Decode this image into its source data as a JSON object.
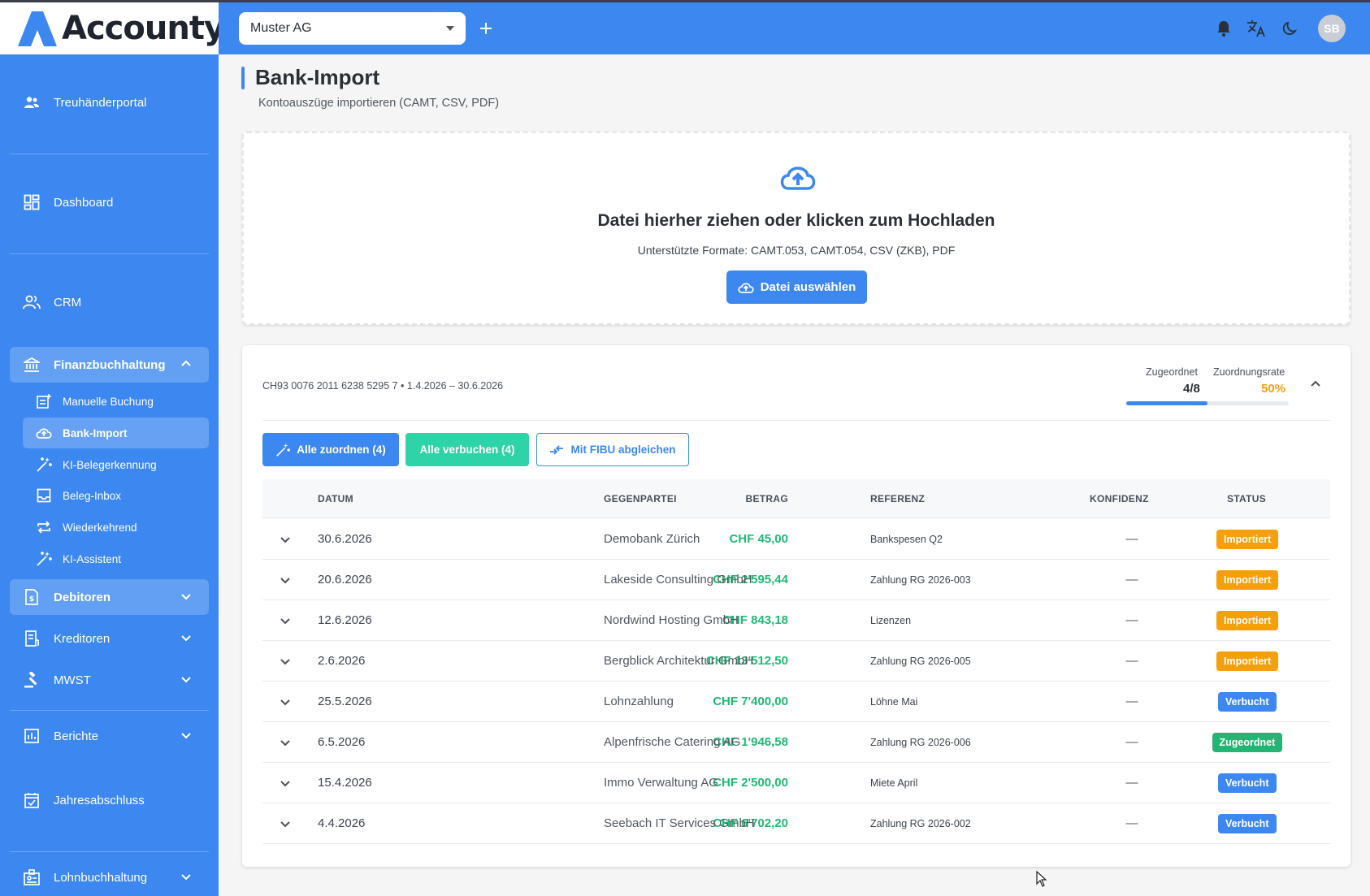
{
  "app": {
    "name": "Accounty",
    "brand_color": "#3d87f0"
  },
  "topbar": {
    "company": "Muster AG",
    "user_initials": "SB"
  },
  "sidebar": {
    "items": [
      {
        "label": "Treuhänderportal"
      },
      {
        "label": "Dashboard"
      },
      {
        "label": "CRM"
      },
      {
        "label": "Finanzbuchhaltung"
      },
      {
        "label": "Debitoren"
      },
      {
        "label": "Kreditoren"
      },
      {
        "label": "MWST"
      },
      {
        "label": "Berichte"
      },
      {
        "label": "Jahresabschluss"
      },
      {
        "label": "Lohnbuchhaltung"
      }
    ],
    "sub_items": [
      {
        "label": "Manuelle Buchung"
      },
      {
        "label": "Bank-Import"
      },
      {
        "label": "KI-Belegerkennung"
      },
      {
        "label": "Beleg-Inbox"
      },
      {
        "label": "Wiederkehrend"
      },
      {
        "label": "KI-Assistent"
      }
    ]
  },
  "page": {
    "title": "Bank-Import",
    "subtitle": "Kontoauszüge importieren (CAMT, CSV, PDF)"
  },
  "upload": {
    "title": "Datei hierher ziehen oder klicken zum Hochladen",
    "formats": "Unterstützte Formate: CAMT.053, CAMT.054, CSV (ZKB), PDF",
    "button": "Datei auswählen"
  },
  "statement": {
    "account_info": "CH93 0076 2011 6238 5295 7 • 1.4.2026 – 30.6.2026",
    "assigned_label": "Zugeordnet",
    "assigned_value": "4/8",
    "rate_label": "Zuordnungsrate",
    "rate_value": "50%",
    "assigned_fraction": 0.5,
    "actions": {
      "assign_all": "Alle zuordnen (4)",
      "book_all": "Alle verbuchen (4)",
      "reconcile": "Mit FIBU abgleichen"
    },
    "columns": {
      "date": "DATUM",
      "amount": "BETRAG",
      "party": "GEGENPARTEI",
      "reference": "REFERENZ",
      "confidence": "KONFIDENZ",
      "status": "STATUS"
    },
    "rows": [
      {
        "date": "30.6.2026",
        "amount": "CHF 45,00",
        "party": "Demobank Zürich",
        "reference": "Bankspesen Q2",
        "confidence": "—",
        "status": "Importiert",
        "status_color": "#f5a00b"
      },
      {
        "date": "20.6.2026",
        "amount": "CHF 2'595,44",
        "party": "Lakeside Consulting GmbH",
        "reference": "Zahlung RG 2026-003",
        "confidence": "—",
        "status": "Importiert",
        "status_color": "#f5a00b"
      },
      {
        "date": "12.6.2026",
        "amount": "CHF 843,18",
        "party": "Nordwind Hosting GmbH",
        "reference": "Lizenzen",
        "confidence": "—",
        "status": "Importiert",
        "status_color": "#f5a00b"
      },
      {
        "date": "2.6.2026",
        "amount": "CHF 13'512,50",
        "party": "Bergblick Architektur GmbH",
        "reference": "Zahlung RG 2026-005",
        "confidence": "—",
        "status": "Importiert",
        "status_color": "#f5a00b"
      },
      {
        "date": "25.5.2026",
        "amount": "CHF 7'400,00",
        "party": "Lohnzahlung",
        "reference": "Löhne Mai",
        "confidence": "—",
        "status": "Verbucht",
        "status_color": "#3d87f0"
      },
      {
        "date": "6.5.2026",
        "amount": "CHF 1'946,58",
        "party": "Alpenfrische Catering AG",
        "reference": "Zahlung RG 2026-006",
        "confidence": "—",
        "status": "Zugeordnet",
        "status_color": "#22b573"
      },
      {
        "date": "15.4.2026",
        "amount": "CHF 2'500,00",
        "party": "Immo Verwaltung AG",
        "reference": "Miete April",
        "confidence": "—",
        "status": "Verbucht",
        "status_color": "#3d87f0"
      },
      {
        "date": "4.4.2026",
        "amount": "CHF 6'702,20",
        "party": "Seebach IT Services GmbH",
        "reference": "Zahlung RG 2026-002",
        "confidence": "—",
        "status": "Verbucht",
        "status_color": "#3d87f0"
      }
    ]
  }
}
